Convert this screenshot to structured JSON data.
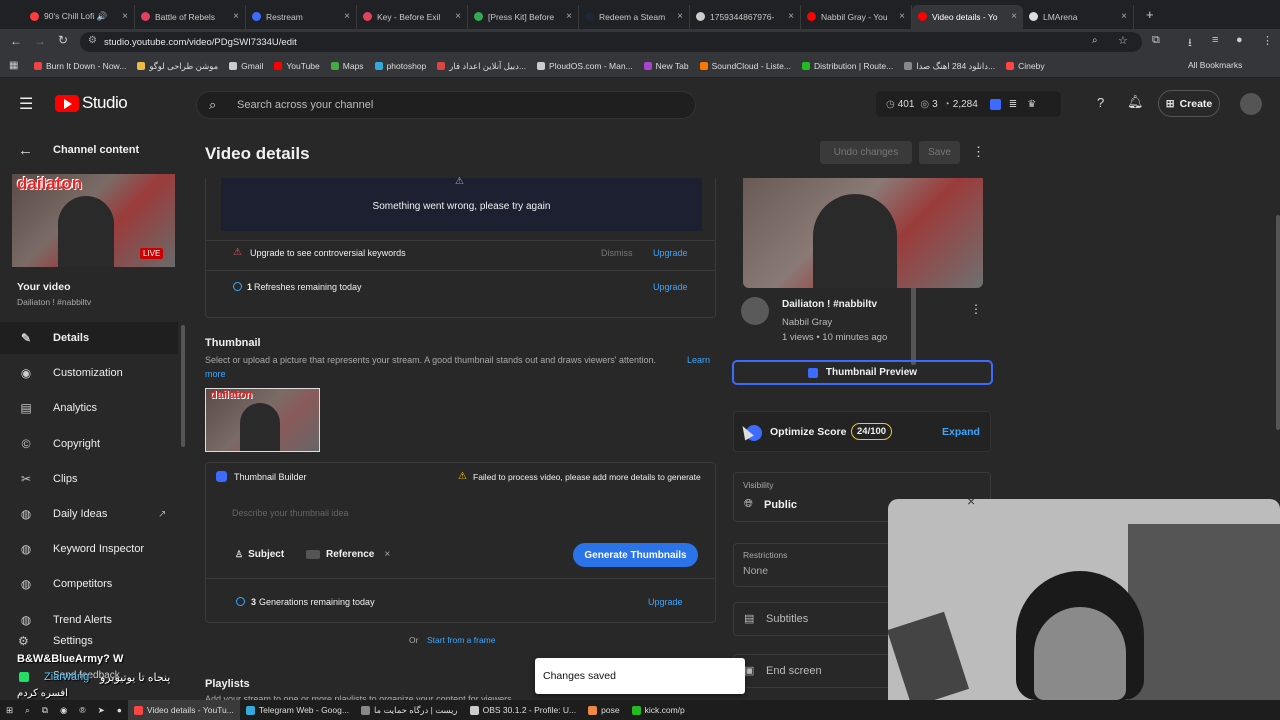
{
  "browser": {
    "tabs": [
      {
        "title": "90's Chill Lofi 🔊",
        "color": "#ff3b3b"
      },
      {
        "title": "Battle of Rebels",
        "color": "#e34060"
      },
      {
        "title": "Restream",
        "color": "#3d6bff"
      },
      {
        "title": "Key - Before Exil",
        "color": "#e34060"
      },
      {
        "title": "[Press Kit] Before",
        "color": "#34a853"
      },
      {
        "title": "Redeem a Steam",
        "color": "#1b2838"
      },
      {
        "title": "1759344867976-",
        "color": "#cccccc"
      },
      {
        "title": "Nabbil Gray - You",
        "color": "#ff0000"
      },
      {
        "title": "Video details - Yo",
        "color": "#ff0000",
        "active": true
      },
      {
        "title": "LMArena",
        "color": "#dddddd"
      }
    ],
    "url": "studio.youtube.com/video/PDgSWI7334U/edit",
    "bookmarks": [
      "Burn It Down - Now...",
      "موشن طراحی لوگو",
      "Gmail",
      "YouTube",
      "Maps",
      "photoshop",
      "دبیل آنلاین اعداد فار...",
      "PloudOS.com - Man...",
      "New Tab",
      "SoundCloud - Liste...",
      "Distribution | Route...",
      "دانلود 284 اهنگ صدا...",
      "Cineby"
    ],
    "all_bookmarks": "All Bookmarks"
  },
  "header": {
    "logo": "Studio",
    "search_placeholder": "Search across your channel",
    "stat1": "401",
    "stat2": "3",
    "stat3": "2,284",
    "create": "Create"
  },
  "sidebar": {
    "back_label": "Channel content",
    "thumb_text": "dailaton",
    "live_badge": "LIVE",
    "your_video": "Your video",
    "video_title": "Dailiaton ! #nabbiltv",
    "items": [
      {
        "label": "Details",
        "icon": "pencil-icon",
        "glyph": "✎"
      },
      {
        "label": "Customization",
        "icon": "broadcast-icon",
        "glyph": "◉"
      },
      {
        "label": "Analytics",
        "icon": "analytics-icon",
        "glyph": "▤"
      },
      {
        "label": "Copyright",
        "icon": "copyright-icon",
        "glyph": "©"
      },
      {
        "label": "Clips",
        "icon": "clips-icon",
        "glyph": "✂"
      },
      {
        "label": "Daily Ideas",
        "icon": "ideas-icon",
        "glyph": "◍"
      },
      {
        "label": "Keyword Inspector",
        "icon": "keyword-icon",
        "glyph": "◍"
      },
      {
        "label": "Competitors",
        "icon": "competitors-icon",
        "glyph": "◍"
      },
      {
        "label": "Trend Alerts",
        "icon": "trend-icon",
        "glyph": "◍"
      }
    ],
    "settings": "Settings",
    "feedback": "Send feedback"
  },
  "main": {
    "title": "Video details",
    "undo": "Undo changes",
    "save": "Save",
    "error_msg": "Something went wrong, please try again",
    "upgrade_keywords": "Upgrade to see controversial keywords",
    "dismiss": "Dismiss",
    "upgrade": "Upgrade",
    "refresh_count": "1",
    "refresh_text": "Refreshes remaining today",
    "thumb_heading": "Thumbnail",
    "thumb_desc": "Select or upload a picture that represents your stream. A good thumbnail stands out and draws viewers' attention.",
    "learn": "Learn",
    "more": "more",
    "tb_title": "Thumbnail Builder",
    "tb_warning": "Failed to process video, please add more details to generate",
    "tb_placeholder": "Describe your thumbnail idea",
    "subject": "Subject",
    "reference": "Reference",
    "generate": "Generate Thumbnails",
    "gen_count": "3",
    "gen_text": "Generations remaining today",
    "or": "Or",
    "start_frame": "Start from a frame",
    "playlists": "Playlists",
    "playlists_sub": "Add your stream to one or more playlists to organize your content for viewers.",
    "toast": "Changes saved"
  },
  "right": {
    "video_title": "Dailiaton ! #nabbiltv",
    "channel": "Nabbil Gray",
    "meta": "1 views • 10 minutes ago",
    "thumb_preview": "Thumbnail Preview",
    "optimize": "Optimize Score",
    "score": "24/100",
    "expand": "Expand",
    "visibility_label": "Visibility",
    "visibility": "Public",
    "restrictions_label": "Restrictions",
    "restrictions": "None",
    "subtitles": "Subtitles",
    "end_screen": "End screen"
  },
  "overlay": {
    "line1": "B&W&BlueArmy? W",
    "line2": "Ziarwang",
    "line3": "پنجاه تا یوتیوبرو",
    "line4": "افسره کردم"
  },
  "taskbar": [
    "Video details - YouTu...",
    "Telegram Web - Goog...",
    "ریست | درگاه حمایت ما",
    "OBS 30.1.2 - Profile: U...",
    "pose",
    "kick.com/p"
  ]
}
